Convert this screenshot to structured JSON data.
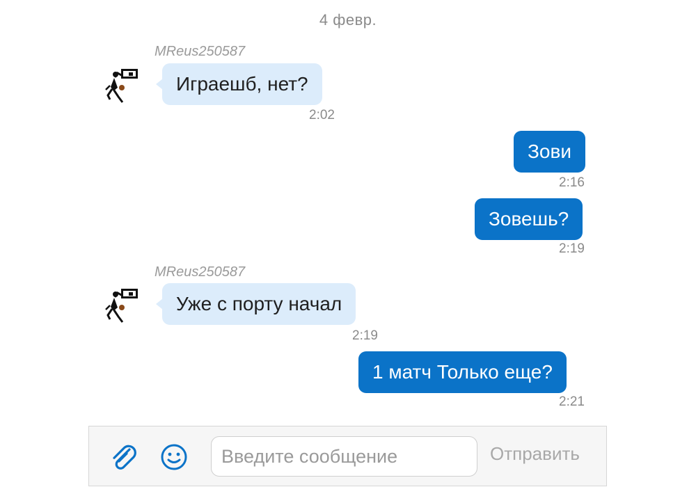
{
  "chat": {
    "date_separator": "4 февр.",
    "messages": [
      {
        "direction": "in",
        "sender": "MReus250587",
        "text": "Играешб, нет?",
        "time": "2:02"
      },
      {
        "direction": "out",
        "text": "Зови",
        "time": "2:16"
      },
      {
        "direction": "out",
        "text": "Зовешь?",
        "time": "2:19"
      },
      {
        "direction": "in",
        "sender": "MReus250587",
        "text": "Уже с порту начал",
        "time": "2:19"
      },
      {
        "direction": "out",
        "text": "1 матч Только еще?",
        "time": "2:21"
      }
    ]
  },
  "composer": {
    "attach_icon": "paperclip-icon",
    "emoji_icon": "smiley-icon",
    "input_value": "",
    "input_placeholder": "Введите сообщение",
    "send_label": "Отправить"
  },
  "colors": {
    "incoming_bubble": "#dcecfb",
    "outgoing_bubble": "#0b73c8",
    "accent": "#0b73c8",
    "muted_text": "#8a8a8a"
  }
}
